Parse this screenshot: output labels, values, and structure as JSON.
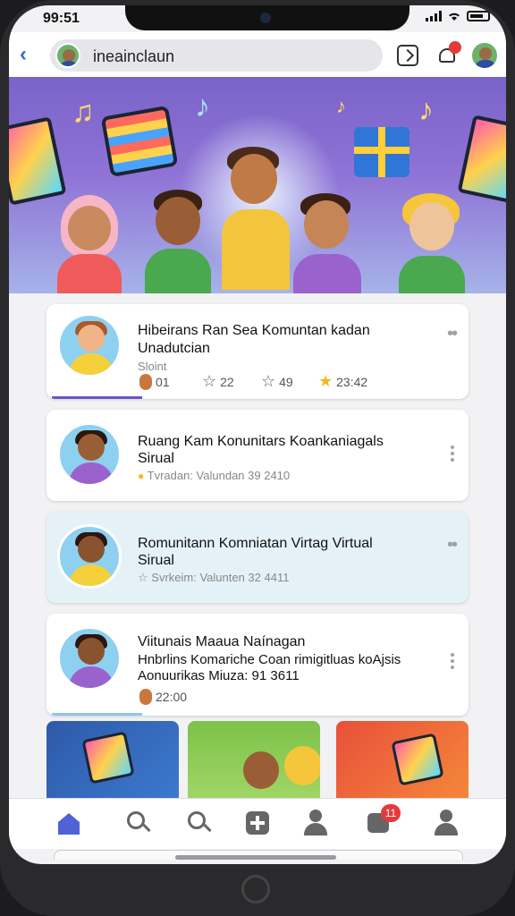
{
  "status_bar": {
    "time": "99:51"
  },
  "top_bar": {
    "channel_name": "ineainclaun",
    "notification_badge": ""
  },
  "cards": [
    {
      "title_line1": "Hibeirans Ran Sea Komuntan kadan",
      "title_line2": "Unadutcian",
      "subtitle": "Sloint",
      "stats": [
        {
          "icon": "avatar-icon",
          "value": "01"
        },
        {
          "icon": "star-outline-icon",
          "value": "22"
        },
        {
          "icon": "star-outline-icon",
          "value": "49"
        },
        {
          "icon": "star-gold-icon",
          "value": "23:42"
        }
      ],
      "progress": 0.22
    },
    {
      "title_line1": "Ruang Kam Konunitars Koankaniagals",
      "title_line2": "Sirual",
      "meta": "Tvradan: Valundan  39 2410"
    },
    {
      "title_line1": "Romunitann Komniatan Virtag Virtual",
      "title_line2": "Sirual",
      "meta": "Svrkeim: Valunten  32 4411"
    },
    {
      "title_line1": "Viitunais Maaua Naínagan",
      "title_line2": "Hnbrlins Komariche Coan rimigitluas koAjsis",
      "title_line3": "Aonuurikas  Miuza: 91 3611",
      "stat_value": "22:00",
      "progress": 0.22
    }
  ],
  "tab_bar": {
    "inbox_badge": "11"
  },
  "colors": {
    "accent": "#4f63d6",
    "badge": "#e53a3a",
    "hero_top": "#7a63c9",
    "card_alt": "#e4f2f7"
  }
}
